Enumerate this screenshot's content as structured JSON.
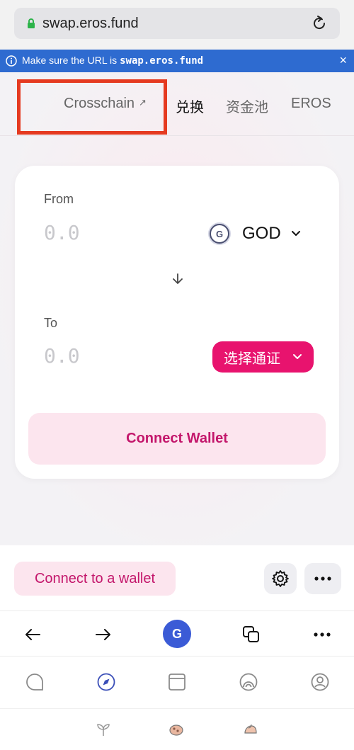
{
  "address_bar": {
    "url": "swap.eros.fund"
  },
  "banner": {
    "text": "Make sure the URL is",
    "url": "swap.eros.fund",
    "close": "×"
  },
  "nav": {
    "items": [
      {
        "label": "Crosschain",
        "external": "↗"
      },
      {
        "label": "兑换"
      },
      {
        "label": "资金池"
      },
      {
        "label": "EROS"
      }
    ]
  },
  "swap": {
    "from_label": "From",
    "from_amount_placeholder": "0.0",
    "from_token": "GOD",
    "from_token_logo": "G",
    "to_label": "To",
    "to_amount_placeholder": "0.0",
    "to_token_button": "选择通证",
    "connect_button": "Connect Wallet"
  },
  "app_bar": {
    "connect_label": "Connect to a wallet"
  },
  "browser_nav": {
    "avatar_letter": "G"
  },
  "colors": {
    "accent": "#e8136e",
    "accent_soft": "#fce5ee",
    "banner": "#2e6bd0",
    "highlight": "#e53a20"
  }
}
